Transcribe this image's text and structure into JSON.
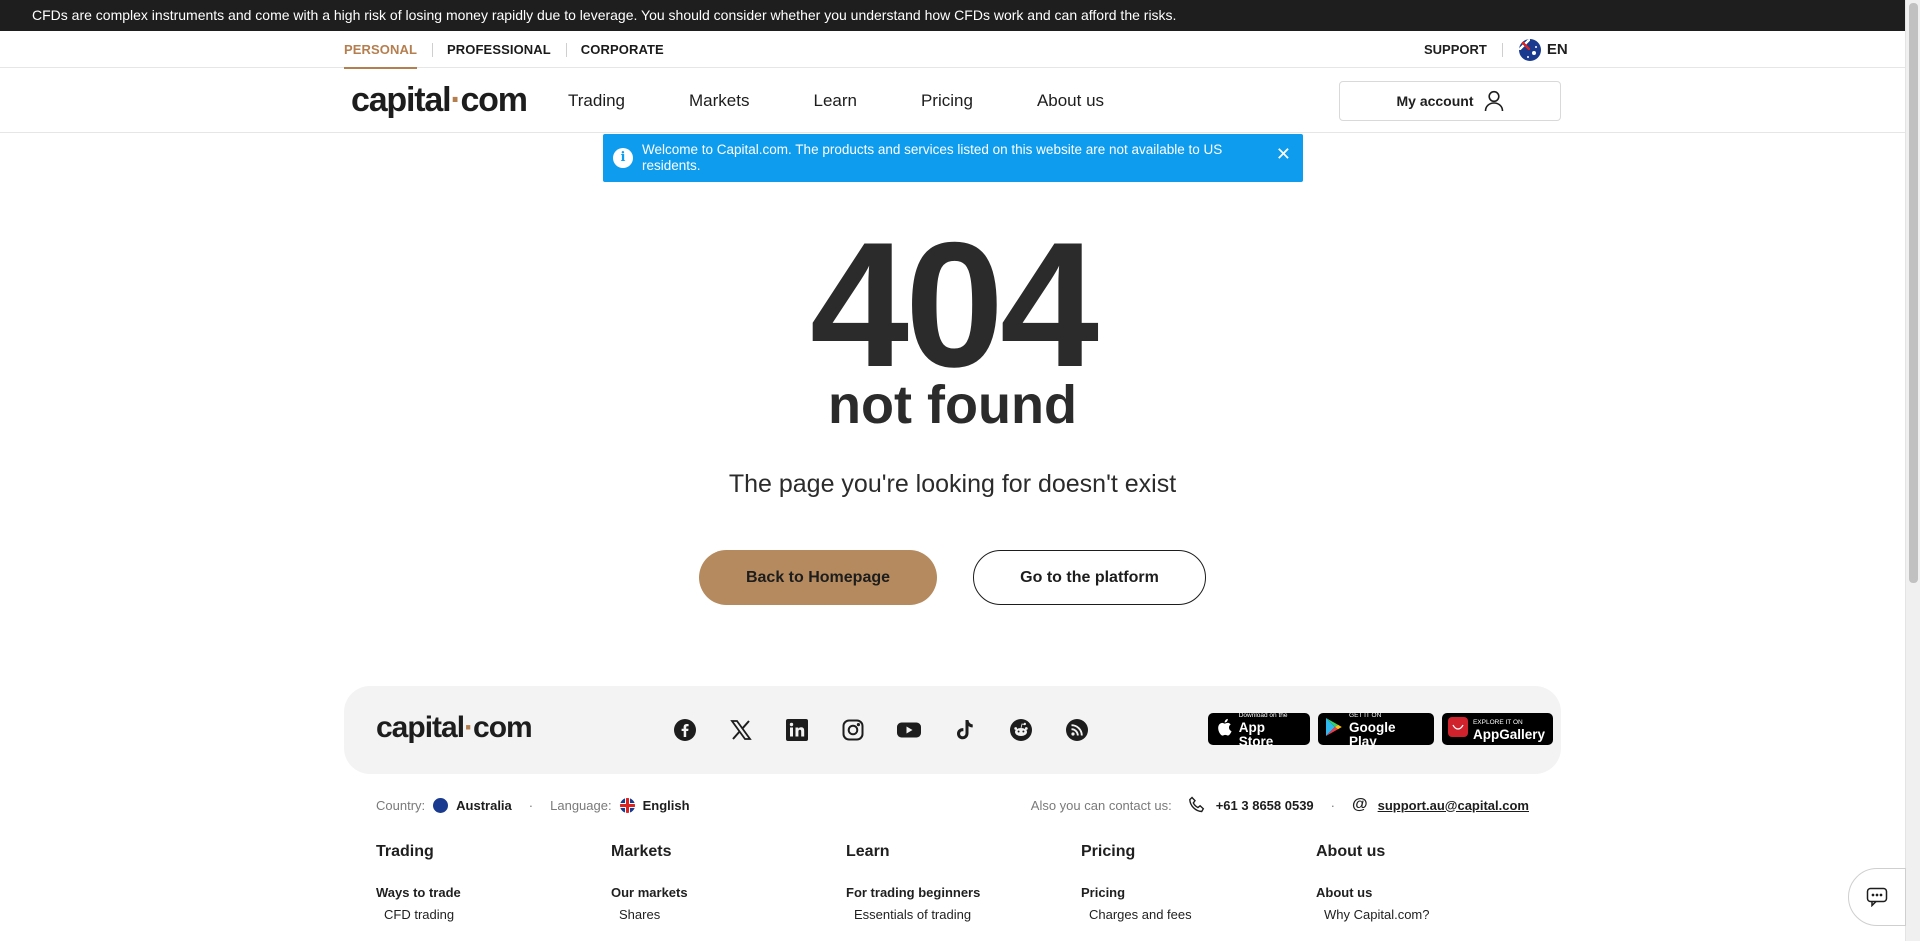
{
  "risk_warning": "CFDs are complex instruments and come with a high risk of losing money rapidly due to leverage. You should consider whether you understand how CFDs work and can afford the risks.",
  "segments": [
    "PERSONAL",
    "PROFESSIONAL",
    "CORPORATE"
  ],
  "top_right": {
    "support": "SUPPORT",
    "language": "EN"
  },
  "logo": {
    "left": "capital",
    "dot": "·",
    "right": "com"
  },
  "nav": [
    "Trading",
    "Markets",
    "Learn",
    "Pricing",
    "About us"
  ],
  "account_button": "My account",
  "alert": {
    "text": "Welcome to Capital.com. The products and services listed on this website are not available to US residents.",
    "close": "✕"
  },
  "error": {
    "code": "404",
    "title": "not found",
    "description": "The page you're looking for doesn't exist"
  },
  "buttons": {
    "home": "Back to Homepage",
    "platform": "Go to the platform"
  },
  "stores": [
    {
      "small": "Download on the",
      "big": "App Store"
    },
    {
      "small": "GET IT ON",
      "big": "Google Play"
    },
    {
      "small": "EXPLORE IT ON",
      "big": "AppGallery"
    }
  ],
  "footer_contact": {
    "country_label": "Country:",
    "country": "Australia",
    "language_label": "Language:",
    "language": "English",
    "contact_label": "Also you can contact us:",
    "phone": "+61 3 8658 0539",
    "email": "support.au@capital.com"
  },
  "footer_columns": [
    {
      "title": "Trading",
      "sub": "Ways to trade",
      "link": "CFD trading"
    },
    {
      "title": "Markets",
      "sub": "Our markets",
      "link": "Shares"
    },
    {
      "title": "Learn",
      "sub": "For trading beginners",
      "link": "Essentials of trading"
    },
    {
      "title": "Pricing",
      "sub": "Pricing",
      "link": "Charges and fees"
    },
    {
      "title": "About us",
      "sub": "About us",
      "link": "Why Capital.com?"
    }
  ],
  "colors": {
    "accent": "#b57e4f",
    "info": "#0e9cee",
    "button_primary": "#b58a5e",
    "dark": "#1e1e1e"
  },
  "icons": [
    "info-icon",
    "close-icon",
    "user-icon",
    "facebook-icon",
    "x-icon",
    "linkedin-icon",
    "instagram-icon",
    "youtube-icon",
    "tiktok-icon",
    "reddit-icon",
    "rss-icon",
    "apple-icon",
    "google-play-icon",
    "huawei-icon",
    "phone-icon",
    "at-icon",
    "chat-icon"
  ]
}
